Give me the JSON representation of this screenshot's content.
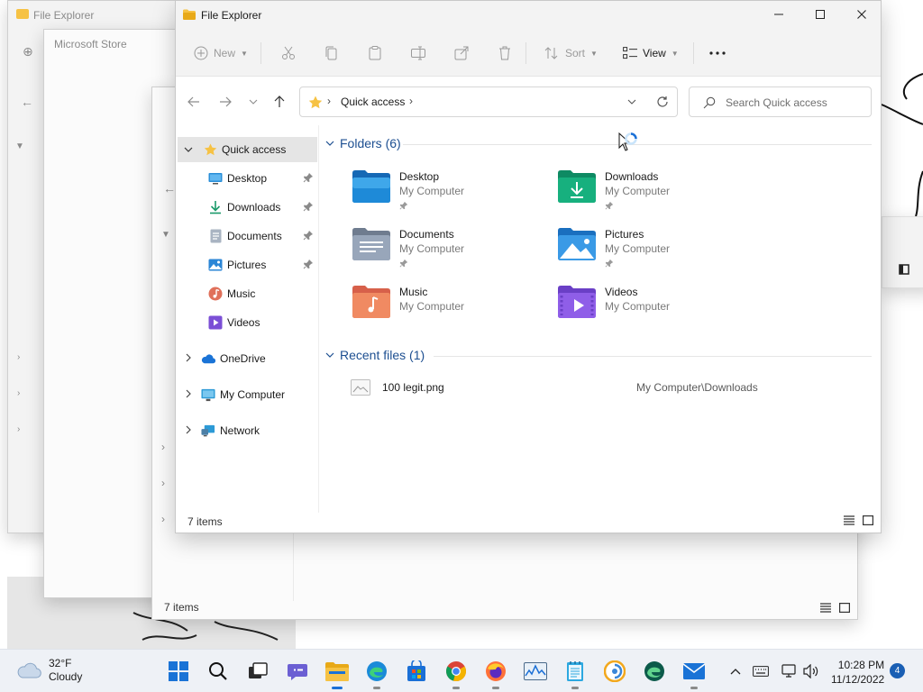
{
  "background_windows": {
    "explorer_left": {
      "title": "File Explorer"
    },
    "store": {
      "title": "Microsoft Store"
    },
    "explorer_back": {
      "status": "7 items"
    }
  },
  "window": {
    "title": "File Explorer",
    "controls": {
      "minimize": "minimize-icon",
      "maximize": "maximize-icon",
      "close": "close-icon"
    }
  },
  "toolbar": {
    "new_label": "New",
    "sort_label": "Sort",
    "view_label": "View",
    "icons": [
      "plus-icon",
      "cut-icon",
      "copy-icon",
      "paste-icon",
      "rename-icon",
      "share-icon",
      "delete-icon",
      "sort-icon",
      "view-icon",
      "more-icon"
    ]
  },
  "address": {
    "location": "Quick access",
    "search_placeholder": "Search Quick access"
  },
  "nav": {
    "quick_access": "Quick access",
    "pinned": [
      {
        "label": "Desktop",
        "icon": "desktop-icon",
        "pinned": true
      },
      {
        "label": "Downloads",
        "icon": "downloads-icon",
        "pinned": true
      },
      {
        "label": "Documents",
        "icon": "documents-icon",
        "pinned": true
      },
      {
        "label": "Pictures",
        "icon": "pictures-icon",
        "pinned": true
      },
      {
        "label": "Music",
        "icon": "music-icon",
        "pinned": false
      },
      {
        "label": "Videos",
        "icon": "videos-icon",
        "pinned": false
      }
    ],
    "roots": [
      {
        "label": "OneDrive",
        "icon": "cloud-icon"
      },
      {
        "label": "My Computer",
        "icon": "computer-icon"
      },
      {
        "label": "Network",
        "icon": "network-icon"
      }
    ]
  },
  "folders": {
    "header": "Folders (6)",
    "items": [
      {
        "name": "Desktop",
        "location": "My Computer",
        "pinned": true,
        "icon": "desktop-folder-icon"
      },
      {
        "name": "Downloads",
        "location": "My Computer",
        "pinned": true,
        "icon": "downloads-folder-icon"
      },
      {
        "name": "Documents",
        "location": "My Computer",
        "pinned": true,
        "icon": "documents-folder-icon"
      },
      {
        "name": "Pictures",
        "location": "My Computer",
        "pinned": true,
        "icon": "pictures-folder-icon"
      },
      {
        "name": "Music",
        "location": "My Computer",
        "pinned": false,
        "icon": "music-folder-icon"
      },
      {
        "name": "Videos",
        "location": "My Computer",
        "pinned": false,
        "icon": "videos-folder-icon"
      }
    ]
  },
  "recent": {
    "header": "Recent files (1)",
    "items": [
      {
        "name": "100 legit.png",
        "location": "My Computer\\Downloads",
        "icon": "image-file-icon"
      }
    ]
  },
  "status": {
    "items": "7 items"
  },
  "taskbar": {
    "weather": {
      "temp": "32°F",
      "condition": "Cloudy",
      "icon": "cloud-icon"
    },
    "apps": [
      "windows-start-icon",
      "search-icon",
      "task-view-icon",
      "chat-icon",
      "file-explorer-icon",
      "edge-icon",
      "store-icon",
      "chrome-icon",
      "firefox-icon",
      "performance-monitor-icon",
      "notepad-icon",
      "vpn-icon",
      "edge-dev-icon",
      "mail-icon"
    ],
    "tray": [
      "chevron-up-icon",
      "keyboard-icon",
      "network-icon",
      "volume-icon"
    ],
    "time": "10:28 PM",
    "date": "11/12/2022",
    "notifications": "4"
  },
  "colors": {
    "accent": "#1a6fd6",
    "group_header": "#1d4f91",
    "selected_nav": "#e5e5e5",
    "folder_yellow": "#f6c244"
  }
}
